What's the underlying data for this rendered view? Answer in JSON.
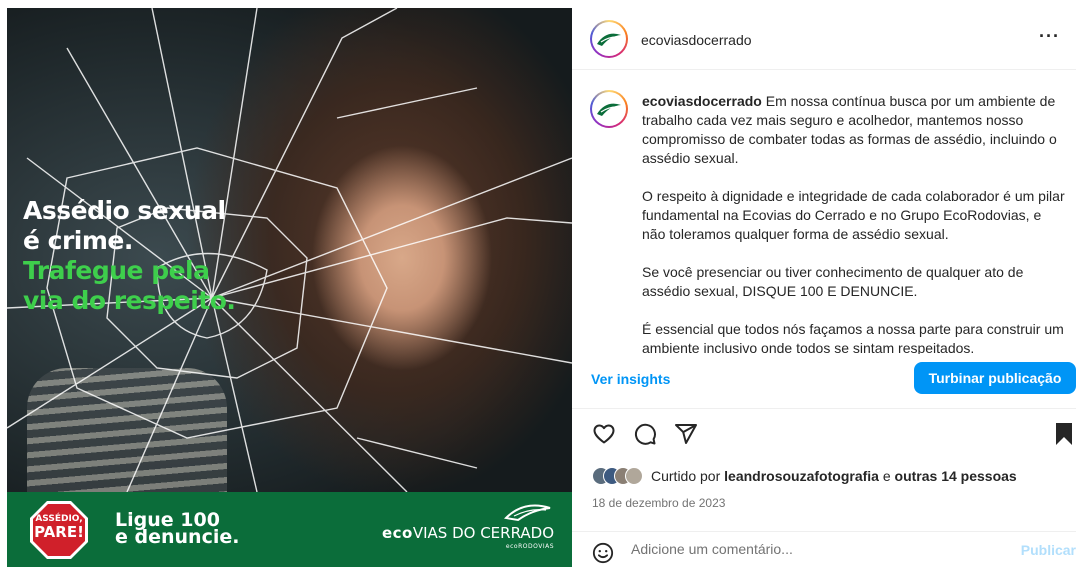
{
  "image": {
    "headline_line1": "Assédio sexual",
    "headline_line2": "é crime.",
    "headline_line3": "Trafegue pela",
    "headline_line4": "via do respeito.",
    "stop_line1": "ASSÉDIO,",
    "stop_line2": "PARE!",
    "ligue_line1": "Ligue 100",
    "ligue_line2": "e denuncie.",
    "brand_bold": "eco",
    "brand_rest": "VIAS DO CERRADO",
    "brand_sub": "ecoRODOVIAS",
    "colors": {
      "band": "#0b6d3a",
      "headline_green": "#3ecf4c",
      "stop_red": "#d0202a"
    }
  },
  "header": {
    "username": "ecoviasdocerrado",
    "more_icon": "more-horizontal-icon"
  },
  "caption": {
    "username": "ecoviasdocerrado",
    "p1": " Em nossa contínua busca por um ambiente de trabalho cada vez mais seguro e acolhedor, mantemos nosso compromisso de combater todas as formas de assédio, incluindo o assédio sexual.",
    "p2": "O respeito à dignidade e integridade de cada colaborador é um pilar fundamental na Ecovias do Cerrado e no Grupo EcoRodovias, e não toleramos qualquer forma de assédio sexual.",
    "p3": "Se você presenciar ou tiver conhecimento de qualquer ato de assédio sexual, DISQUE 100 E DENUNCIE.",
    "p4": "É essencial que todos nós façamos a nossa parte para construir um ambiente inclusivo onde todos se sintam respeitados."
  },
  "insights": {
    "link": "Ver insights",
    "boost_button": "Turbinar publicação"
  },
  "actions": [
    "heart-icon",
    "comment-icon",
    "share-icon",
    "bookmark-icon"
  ],
  "likes": {
    "prefix": "Curtido por ",
    "user": "leandrosouzafotografia",
    "middle": " e ",
    "others": "outras 14 pessoas"
  },
  "date": "18 de dezembro de 2023",
  "comment": {
    "placeholder": "Adicione um comentário...",
    "post_button": "Publicar"
  },
  "accent": "#0095f6"
}
